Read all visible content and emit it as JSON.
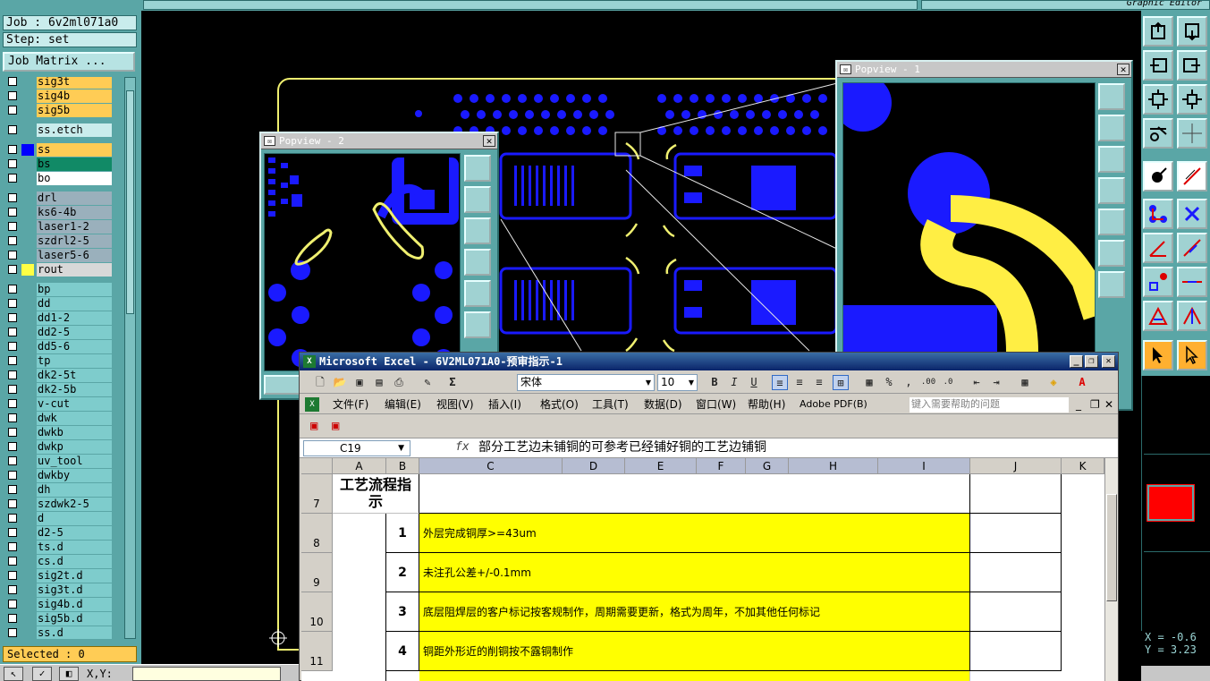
{
  "app": {
    "graphic_editor_title": "Graphic Editor"
  },
  "left_panel": {
    "job_label": "Job : 6v2ml071a0",
    "step_label": "Step: set",
    "job_matrix_button": "Job Matrix ...",
    "selected_label": "Selected : 0",
    "layers": [
      {
        "name": "sig3t",
        "color": "#ffcc55",
        "swatch": ""
      },
      {
        "name": "sig4b",
        "color": "#ffcc55",
        "swatch": ""
      },
      {
        "name": "sig5b",
        "color": "#ffcc55",
        "swatch": ""
      },
      {
        "name": "ss.etch",
        "color": "#c9ecec",
        "swatch": ""
      },
      {
        "name": "ss",
        "color": "#ffcc55",
        "swatch": "#0000ff"
      },
      {
        "name": "bs",
        "color": "#118a66",
        "swatch": ""
      },
      {
        "name": "bo",
        "color": "#ffffff",
        "swatch": ""
      },
      {
        "name": "drl",
        "color": "#9ab0bc",
        "swatch": ""
      },
      {
        "name": "ks6-4b",
        "color": "#9ab0bc",
        "swatch": ""
      },
      {
        "name": "laser1-2",
        "color": "#9ab0bc",
        "swatch": ""
      },
      {
        "name": "szdrl2-5",
        "color": "#9ab0bc",
        "swatch": ""
      },
      {
        "name": "laser5-6",
        "color": "#9ab0bc",
        "swatch": ""
      },
      {
        "name": "rout",
        "color": "#d8d8d8",
        "swatch": "#ffff44"
      },
      {
        "name": "bp",
        "color": "#7ecccc",
        "swatch": ""
      },
      {
        "name": "dd",
        "color": "#7ecccc",
        "swatch": ""
      },
      {
        "name": "dd1-2",
        "color": "#7ecccc",
        "swatch": ""
      },
      {
        "name": "dd2-5",
        "color": "#7ecccc",
        "swatch": ""
      },
      {
        "name": "dd5-6",
        "color": "#7ecccc",
        "swatch": ""
      },
      {
        "name": "tp",
        "color": "#7ecccc",
        "swatch": ""
      },
      {
        "name": "dk2-5t",
        "color": "#7ecccc",
        "swatch": ""
      },
      {
        "name": "dk2-5b",
        "color": "#7ecccc",
        "swatch": ""
      },
      {
        "name": "v-cut",
        "color": "#7ecccc",
        "swatch": ""
      },
      {
        "name": "dwk",
        "color": "#7ecccc",
        "swatch": ""
      },
      {
        "name": "dwkb",
        "color": "#7ecccc",
        "swatch": ""
      },
      {
        "name": "dwkp",
        "color": "#7ecccc",
        "swatch": ""
      },
      {
        "name": "uv_tool",
        "color": "#7ecccc",
        "swatch": ""
      },
      {
        "name": "dwkby",
        "color": "#7ecccc",
        "swatch": ""
      },
      {
        "name": "dh",
        "color": "#7ecccc",
        "swatch": ""
      },
      {
        "name": "szdwk2-5",
        "color": "#7ecccc",
        "swatch": ""
      },
      {
        "name": "d",
        "color": "#7ecccc",
        "swatch": ""
      },
      {
        "name": "d2-5",
        "color": "#7ecccc",
        "swatch": ""
      },
      {
        "name": "ts.d",
        "color": "#7ecccc",
        "swatch": ""
      },
      {
        "name": "cs.d",
        "color": "#7ecccc",
        "swatch": ""
      },
      {
        "name": "sig2t.d",
        "color": "#7ecccc",
        "swatch": ""
      },
      {
        "name": "sig3t.d",
        "color": "#7ecccc",
        "swatch": ""
      },
      {
        "name": "sig4b.d",
        "color": "#7ecccc",
        "swatch": ""
      },
      {
        "name": "sig5b.d",
        "color": "#7ecccc",
        "swatch": ""
      },
      {
        "name": "ss.d",
        "color": "#7ecccc",
        "swatch": ""
      }
    ]
  },
  "bottom_bar": {
    "xy_label": "X,Y:"
  },
  "popview2": {
    "title": "Popview - 2"
  },
  "popview1": {
    "title": "Popview - 1"
  },
  "coords": {
    "x": "X = -0.6",
    "y": "Y = 3.23"
  },
  "excel": {
    "title": "Microsoft Excel - 6V2ML071A0-预审指示-1",
    "font_name": "宋体",
    "font_size": "10",
    "menu": [
      "文件(F)",
      "编辑(E)",
      "视图(V)",
      "插入(I)",
      "格式(O)",
      "工具(T)",
      "数据(D)",
      "窗口(W)",
      "帮助(H)",
      "Adobe PDF(B)"
    ],
    "help_placeholder": "键入需要帮助的问题",
    "name_box": "C19",
    "formula": "部分工艺边未铺铜的可参考已经铺好铜的工艺边铺铜",
    "columns": [
      "A",
      "B",
      "C",
      "D",
      "E",
      "F",
      "G",
      "H",
      "I",
      "J",
      "K"
    ],
    "rows": [
      {
        "row": "7",
        "a": "工艺流程指示",
        "b": "",
        "text": ""
      },
      {
        "row": "8",
        "a": "",
        "b": "1",
        "text": "外层完成铜厚>=43um"
      },
      {
        "row": "9",
        "a": "",
        "b": "2",
        "text": "未注孔公差+/-0.1mm"
      },
      {
        "row": "10",
        "a": "",
        "b": "3",
        "text": "底层阻焊层的客户标记按客规制作，周期需要更新，格式为周年，不加其他任何标记"
      },
      {
        "row": "11",
        "a": "",
        "b": "4",
        "text": "铜距外形近的削铜按不露铜制作"
      }
    ],
    "highlight_color": "#ffff00"
  }
}
